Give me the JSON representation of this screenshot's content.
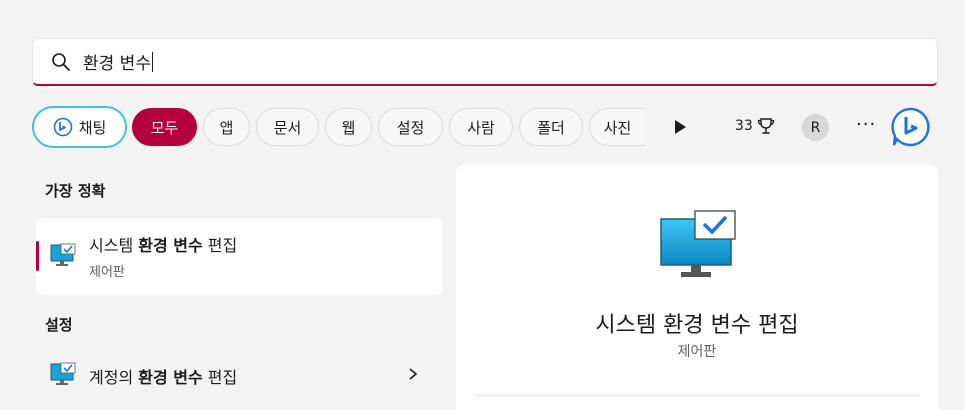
{
  "search": {
    "query": "환경 변수"
  },
  "filters": {
    "chat_label": "채팅",
    "items": [
      "모두",
      "앱",
      "문서",
      "웹",
      "설정",
      "사람",
      "폴더",
      "사진"
    ],
    "points": "33",
    "avatar_initial": "R",
    "more_label": "···"
  },
  "best_match": {
    "header": "가장 정확",
    "title_prefix": "시스템 ",
    "title_bold": "환경 변수",
    "title_suffix": " 편집",
    "subtitle": "제어판"
  },
  "settings": {
    "header": "설정",
    "title_prefix": "계정의 ",
    "title_bold": "환경 변수",
    "title_suffix": " 편집"
  },
  "detail": {
    "title": "시스템 환경 변수 편집",
    "subtitle": "제어판"
  },
  "colors": {
    "accent": "#b4003d",
    "chat_border": "#3fc3d8"
  }
}
